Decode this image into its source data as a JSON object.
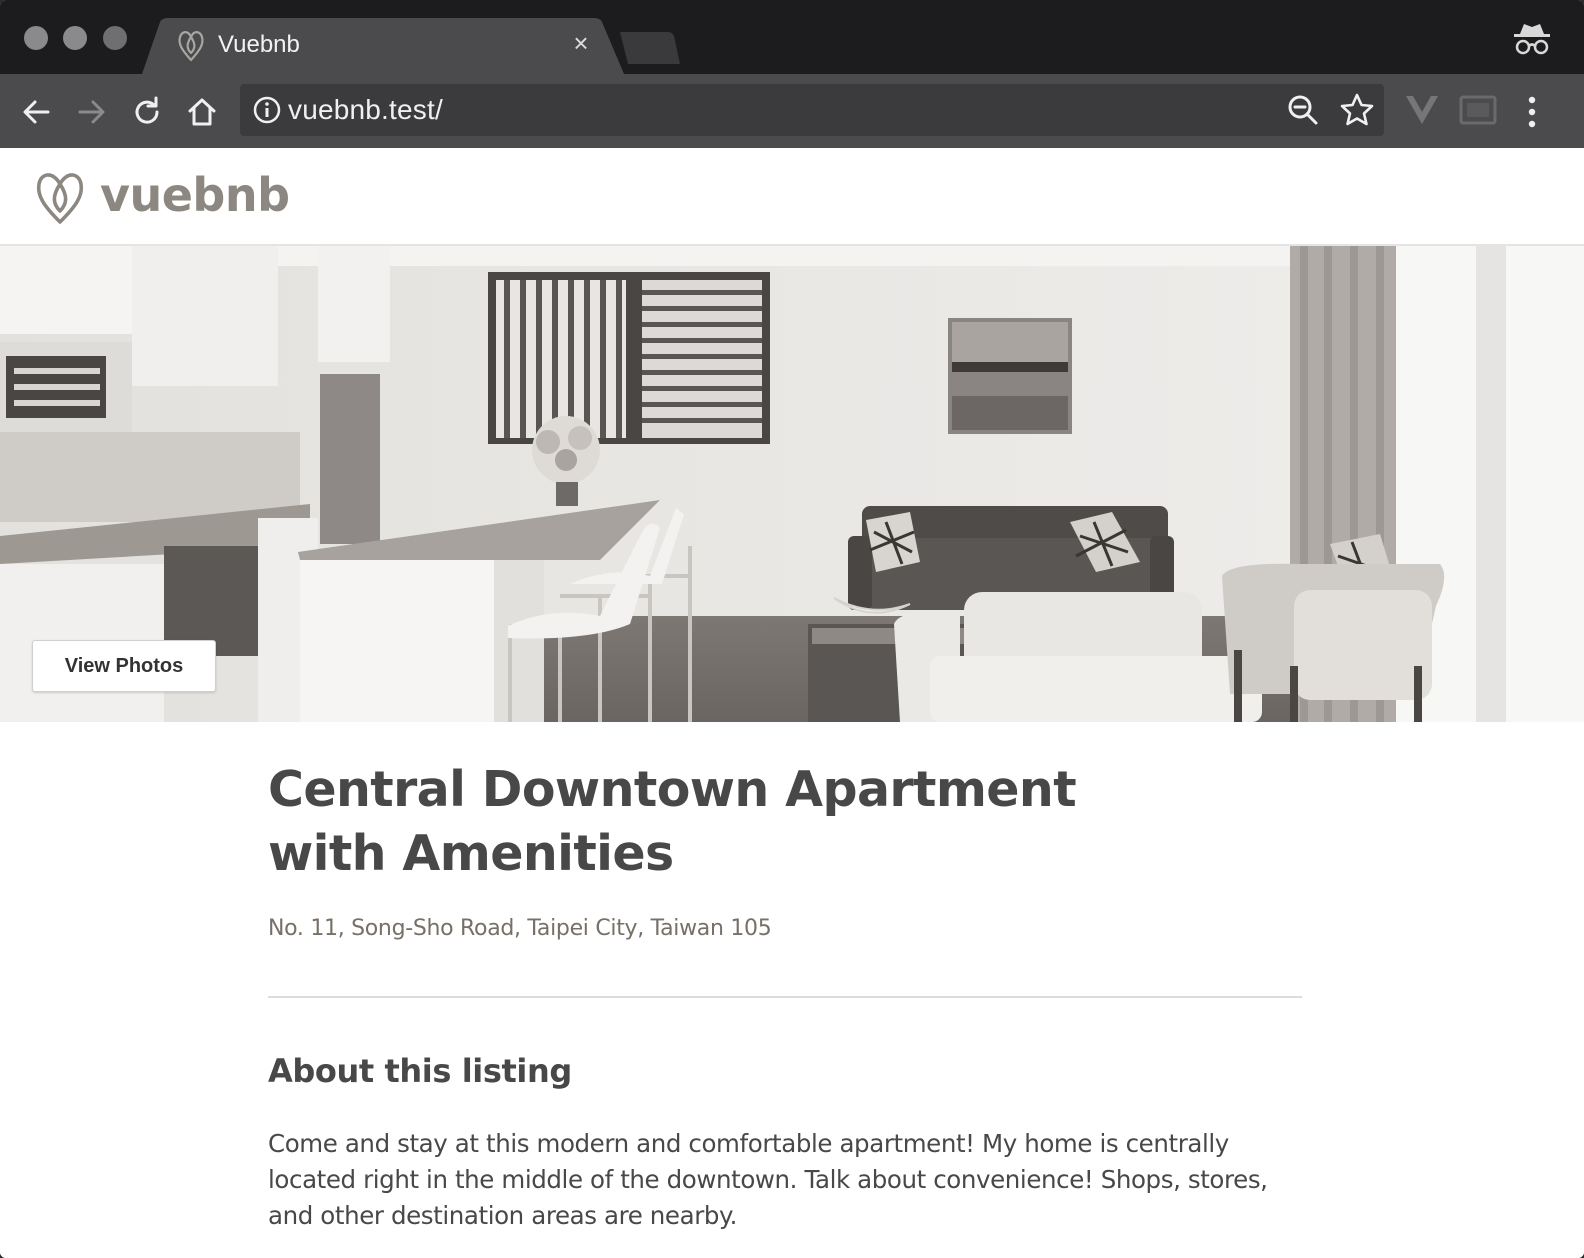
{
  "browser": {
    "tab_title": "Vuebnb",
    "tab_close": "×",
    "url": "vuebnb.test/",
    "icons": [
      "vuebnb-favicon-icon",
      "back-arrow-icon",
      "forward-arrow-icon",
      "reload-icon",
      "home-icon",
      "info-icon",
      "zoom-icon",
      "star-icon",
      "vue-extension-icon",
      "cast-icon",
      "menu-dots-icon",
      "incognito-icon"
    ]
  },
  "site": {
    "name": "vuebnb",
    "accent_color": "#8c8780"
  },
  "hero": {
    "button_label": "View Photos"
  },
  "listing": {
    "title": "Central Downtown Apartment with Amenities",
    "address": "No. 11, Song-Sho Road, Taipei City, Taiwan 105",
    "about_heading": "About this listing",
    "about_text": "Come and stay at this modern and comfortable apartment! My home is centrally located right in the middle of the downtown. Talk about convenience! Shops, stores, and other destination areas are nearby."
  }
}
